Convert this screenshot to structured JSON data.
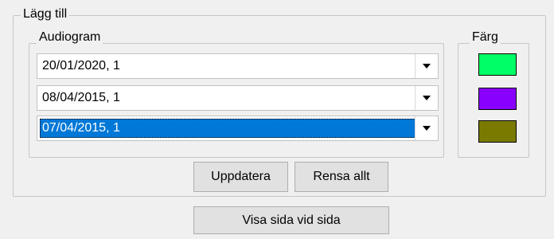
{
  "add_group": {
    "title": "Lägg till"
  },
  "audiogram_group": {
    "title": "Audiogram",
    "items": [
      {
        "value": "20/01/2020, 1",
        "selected": false
      },
      {
        "value": "08/04/2015, 1",
        "selected": false
      },
      {
        "value": "07/04/2015, 1",
        "selected": true
      }
    ]
  },
  "color_group": {
    "title": "Färg",
    "swatches": [
      {
        "color": "#00ff66"
      },
      {
        "color": "#8a00ff"
      },
      {
        "color": "#7a7a00"
      }
    ]
  },
  "buttons": {
    "update_label": "Uppdatera",
    "clear_all_label": "Rensa allt",
    "side_by_side_label": "Visa sida vid sida"
  },
  "colors": {
    "selection": "#0078d7",
    "background": "#f0f0f0"
  }
}
